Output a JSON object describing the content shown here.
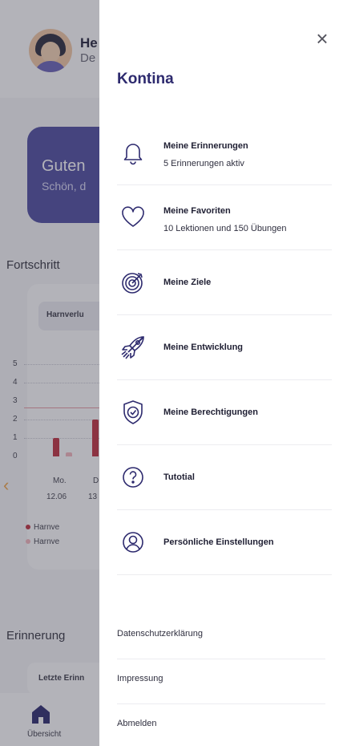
{
  "background": {
    "header": {
      "name_partial": "He",
      "sub_partial": "De"
    },
    "greeting": {
      "title_partial": "Guten",
      "sub_partial": "Schön, d"
    },
    "progress_section": "Fortschritt",
    "chart_chip": "Harnverlu",
    "reminders_section": "Erinnerung",
    "reminder_card": "Letzte Erinn",
    "bottom_nav": {
      "home_label": "Übersicht"
    }
  },
  "chart_data": {
    "type": "bar",
    "y_ticks": [
      "5",
      "4",
      "3",
      "2",
      "1",
      "0"
    ],
    "ylim": [
      0,
      5
    ],
    "reference_line": 3,
    "x_tick_days": [
      "Mo.",
      "D"
    ],
    "x_tick_dates": [
      "12.06",
      "13"
    ],
    "series": [
      {
        "name": "Harnve",
        "color": "#c0313f",
        "values": [
          1,
          2
        ]
      },
      {
        "name": "Harnve",
        "color": "#f4b7bd",
        "values": [
          0.2
        ]
      }
    ]
  },
  "drawer": {
    "brand": "Kontina",
    "close_label": "×",
    "menu": [
      {
        "icon": "bell-icon",
        "title": "Meine Erinnerungen",
        "sub": "5 Erinnerungen aktiv"
      },
      {
        "icon": "heart-icon",
        "title": "Meine Favoriten",
        "sub": "10 Lektionen und 150 Übungen"
      },
      {
        "icon": "target-icon",
        "title": "Meine Ziele"
      },
      {
        "icon": "rocket-icon",
        "title": "Meine Entwicklung"
      },
      {
        "icon": "shield-check-icon",
        "title": "Meine Berechtigungen"
      },
      {
        "icon": "question-circle-icon",
        "title": "Tutotial"
      },
      {
        "icon": "user-circle-icon",
        "title": "Persönliche Einstellungen"
      }
    ],
    "footer": [
      "Datenschutzerklärung",
      "Impressung",
      "Abmelden"
    ]
  },
  "colors": {
    "brand": "#2d2a6e",
    "accent": "#4e4ca1",
    "chart_red": "#c0313f",
    "chart_pink": "#f4b7bd"
  }
}
